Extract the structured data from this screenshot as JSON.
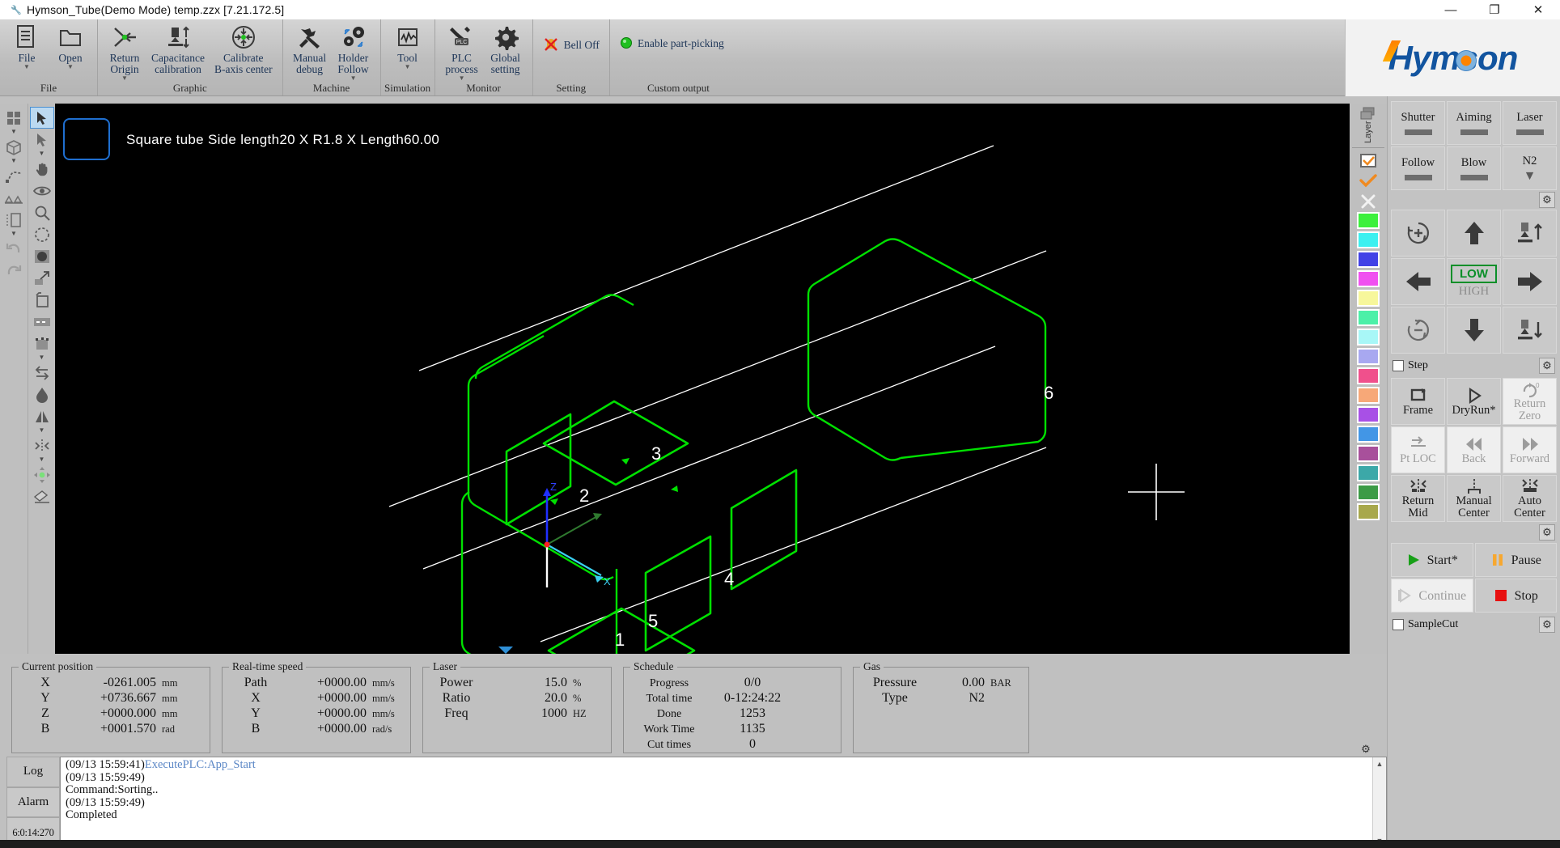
{
  "window": {
    "title": "Hymson_Tube(Demo Mode) temp.zzx  [7.21.172.5]",
    "app_icon": "app-icon",
    "minimize": "—",
    "maximize": "❐",
    "close": "✕"
  },
  "logo": {
    "text": "Hymson"
  },
  "ribbon": {
    "groups": [
      {
        "title": "File",
        "buttons": [
          {
            "label": "File",
            "icon": "document-icon",
            "caret": true
          },
          {
            "label": "Open",
            "icon": "folder-icon",
            "caret": true
          }
        ]
      },
      {
        "title": "Graphic",
        "buttons": [
          {
            "label": "Return\nOrigin",
            "icon": "return-origin-icon",
            "caret": true
          },
          {
            "label": "Capacitance\ncalibration",
            "icon": "capacitance-calibration-icon",
            "caret": false
          },
          {
            "label": "Calibrate\nB-axis center",
            "icon": "calibrate-b-axis-icon",
            "caret": false
          }
        ]
      },
      {
        "title": "Machine",
        "buttons": [
          {
            "label": "Manual\ndebug",
            "icon": "wrench-icon",
            "caret": false
          },
          {
            "label": "Holder\nFollow",
            "icon": "holder-follow-icon",
            "caret": true
          }
        ]
      },
      {
        "title": "Simulation",
        "buttons": [
          {
            "label": "Tool",
            "icon": "waveform-icon",
            "caret": true
          }
        ]
      },
      {
        "title": "Monitor",
        "buttons": [
          {
            "label": "PLC\nprocess",
            "icon": "plc-icon",
            "caret": true
          },
          {
            "label": "Global\nsetting",
            "icon": "gear-icon",
            "caret": false
          }
        ]
      },
      {
        "title": "Setting",
        "buttons": [
          {
            "label": "Bell Off",
            "icon": "bell-off-icon",
            "horiz": true
          }
        ]
      },
      {
        "title": "Custom output",
        "buttons": [
          {
            "label": "Enable part-picking",
            "icon": "green-dot-icon",
            "horiz": true
          }
        ]
      }
    ]
  },
  "left_tools": {
    "col1": [
      {
        "name": "grid-view-icon",
        "caret": true
      },
      {
        "name": "cube-3d-icon",
        "caret": true
      },
      {
        "name": "curve-path-icon",
        "caret": false
      },
      {
        "name": "bend-icon",
        "caret": false
      },
      {
        "name": "measure-icon",
        "caret": true
      },
      {
        "name": "undo-icon",
        "caret": false
      },
      {
        "name": "redo-icon",
        "caret": false
      }
    ],
    "col2": [
      {
        "name": "select-arrow-icon",
        "caret": false,
        "selected": true
      },
      {
        "name": "pointer-icon",
        "caret": true
      },
      {
        "name": "pan-hand-icon",
        "caret": false
      },
      {
        "name": "eye-visibility-icon",
        "caret": false
      },
      {
        "name": "zoom-magnifier-icon",
        "caret": false
      },
      {
        "name": "dashed-circle-icon",
        "caret": false
      },
      {
        "name": "filled-circle-icon",
        "caret": false
      },
      {
        "name": "scale-arrow-icon",
        "caret": false
      },
      {
        "name": "copy-frame-icon",
        "caret": false
      },
      {
        "name": "dashed-line-icon",
        "caret": false
      },
      {
        "name": "node-select-icon",
        "caret": true
      },
      {
        "name": "swap-direction-icon",
        "caret": false
      },
      {
        "name": "droplet-icon",
        "caret": false
      },
      {
        "name": "mirror-icon",
        "caret": true
      },
      {
        "name": "center-align-icon",
        "caret": true
      },
      {
        "name": "origin-move-icon",
        "caret": false
      },
      {
        "name": "eraser-icon",
        "caret": false
      }
    ]
  },
  "canvas": {
    "title": "Square tube Side length20 X R1.8 X Length60.00",
    "marker_labels": [
      "1",
      "2",
      "3",
      "4",
      "5",
      "6"
    ],
    "axis_labels": {
      "x": "X",
      "z": "Z"
    },
    "colors": {
      "geometry": "#00e000",
      "guide": "#ffffff",
      "z_axis": "#2030ff",
      "x_axis": "#28c8f0",
      "background": "#000000"
    }
  },
  "palette": {
    "layer_label": "Layer",
    "rows": [
      {
        "name": "check-box-orange-icon",
        "type": "icon"
      },
      {
        "name": "check-orange-icon",
        "type": "icon"
      },
      {
        "name": "close-x-icon",
        "type": "icon"
      }
    ],
    "colors": [
      "#3cf03c",
      "#3cf0f0",
      "#4242e6",
      "#f050f0",
      "#f7f79b",
      "#4cf0a8",
      "#a8f7f7",
      "#a8a8f0",
      "#f0508c",
      "#f7a878",
      "#a850e6",
      "#4296e6",
      "#a8509b",
      "#3ca8a8",
      "#3c9b46",
      "#a8a84c"
    ]
  },
  "right_panel": {
    "head_buttons": [
      {
        "label": "Shutter",
        "state": "bar"
      },
      {
        "label": "Aiming",
        "state": "bar"
      },
      {
        "label": "Laser",
        "state": "bar"
      },
      {
        "label": "Follow",
        "state": "bar"
      },
      {
        "label": "Blow",
        "state": "bar"
      },
      {
        "label": "N2",
        "state": "caret"
      }
    ],
    "jog_pad": [
      {
        "name": "rotate-plus-icon",
        "label": ""
      },
      {
        "name": "arrow-up-icon",
        "label": ""
      },
      {
        "name": "nozzle-up-icon",
        "label": ""
      },
      {
        "name": "arrow-left-icon",
        "label": ""
      },
      {
        "name": "speed-toggle",
        "label": "LOW",
        "label2": "HIGH"
      },
      {
        "name": "arrow-right-icon",
        "label": ""
      },
      {
        "name": "rotate-minus-icon",
        "label": ""
      },
      {
        "name": "arrow-down-icon",
        "label": ""
      },
      {
        "name": "nozzle-down-icon",
        "label": ""
      }
    ],
    "step_checkbox": {
      "label": "Step",
      "checked": false
    },
    "action_buttons": [
      {
        "label": "Frame",
        "icon": "frame-icon",
        "disabled": false
      },
      {
        "label": "DryRun*",
        "icon": "play-outline-icon",
        "disabled": false
      },
      {
        "label": "Return\nZero",
        "icon": "return-zero-icon",
        "disabled": true
      },
      {
        "label": "Pt LOC",
        "icon": "point-loc-icon",
        "disabled": true
      },
      {
        "label": "Back",
        "icon": "rewind-icon",
        "disabled": true
      },
      {
        "label": "Forward",
        "icon": "fast-forward-icon",
        "disabled": true
      },
      {
        "label": "Return\nMid",
        "icon": "return-mid-icon",
        "disabled": false
      },
      {
        "label": "Manual\nCenter",
        "icon": "manual-center-icon",
        "disabled": false
      },
      {
        "label": "Auto\nCenter",
        "icon": "auto-center-icon",
        "disabled": false
      }
    ],
    "run_buttons": [
      {
        "label": "Start*",
        "icon": "play-icon",
        "color": "#18a018",
        "disabled": false
      },
      {
        "label": "Pause",
        "icon": "pause-icon",
        "color": "#f7a830",
        "disabled": false
      },
      {
        "label": "Continue",
        "icon": "continue-icon",
        "color": "#c8c8c8",
        "disabled": true
      },
      {
        "label": "Stop",
        "icon": "stop-icon",
        "color": "#e81010",
        "disabled": false
      }
    ],
    "samplecut_checkbox": {
      "label": "SampleCut",
      "checked": false
    }
  },
  "status": {
    "current_position": {
      "title": "Current position",
      "rows": [
        {
          "k": "X",
          "v": "-0261.005",
          "u": "mm"
        },
        {
          "k": "Y",
          "v": "+0736.667",
          "u": "mm"
        },
        {
          "k": "Z",
          "v": "+0000.000",
          "u": "mm"
        },
        {
          "k": "B",
          "v": "+0001.570",
          "u": "rad"
        }
      ]
    },
    "realtime_speed": {
      "title": "Real-time speed",
      "rows": [
        {
          "k": "Path",
          "v": "+0000.00",
          "u": "mm/s"
        },
        {
          "k": "X",
          "v": "+0000.00",
          "u": "mm/s"
        },
        {
          "k": "Y",
          "v": "+0000.00",
          "u": "mm/s"
        },
        {
          "k": "B",
          "v": "+0000.00",
          "u": "rad/s"
        }
      ]
    },
    "laser": {
      "title": "Laser",
      "rows": [
        {
          "k": "Power",
          "v": "15.0",
          "u": "%"
        },
        {
          "k": "Ratio",
          "v": "20.0",
          "u": "%"
        },
        {
          "k": "Freq",
          "v": "1000",
          "u": "HZ"
        }
      ]
    },
    "schedule": {
      "title": "Schedule",
      "rows": [
        {
          "k": "Progress",
          "v": "0/0",
          "u": ""
        },
        {
          "k": "Total time",
          "v": "0-12:24:22",
          "u": ""
        },
        {
          "k": "Done",
          "v": "1253",
          "u": ""
        },
        {
          "k": "Work Time",
          "v": "1135",
          "u": ""
        },
        {
          "k": "Cut times",
          "v": "0",
          "u": ""
        }
      ]
    },
    "gas": {
      "title": "Gas",
      "rows": [
        {
          "k": "Pressure",
          "v": "0.00",
          "u": "BAR"
        },
        {
          "k": "Type",
          "v": "N2",
          "u": ""
        }
      ]
    }
  },
  "log": {
    "tabs": [
      {
        "label": "Log",
        "active": true
      },
      {
        "label": "Alarm",
        "active": false
      },
      {
        "label": "6:0:14:270",
        "active": false
      }
    ],
    "lines": [
      {
        "ts": "(09/13 15:59:41)",
        "ev": "ExecutePLC:App_Start"
      },
      {
        "ts": "(09/13 15:59:49)",
        "ev": ""
      },
      {
        "ts": "Command:Sorting..",
        "ev": ""
      },
      {
        "ts": "(09/13 15:59:49)",
        "ev": ""
      },
      {
        "ts": "Completed",
        "ev": ""
      }
    ]
  }
}
